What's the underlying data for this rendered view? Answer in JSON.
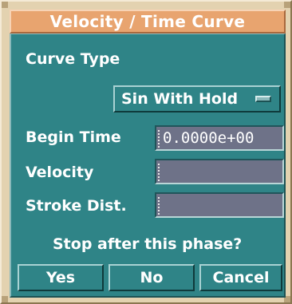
{
  "dialog": {
    "title": "Velocity / Time Curve",
    "curve_type_label": "Curve Type",
    "curve_type_value": "Sin With Hold",
    "fields": [
      {
        "label": "Begin Time",
        "value": "0.0000e+00"
      },
      {
        "label": "Velocity",
        "value": ""
      },
      {
        "label": "Stroke Dist.",
        "value": ""
      }
    ],
    "question": "Stop after this phase?",
    "buttons": {
      "yes": "Yes",
      "no": "No",
      "cancel": "Cancel"
    }
  },
  "colors": {
    "title_bar": "#e8a46f",
    "panel": "#2f8487",
    "field": "#6e7288",
    "frame": "#e3d2b0"
  }
}
